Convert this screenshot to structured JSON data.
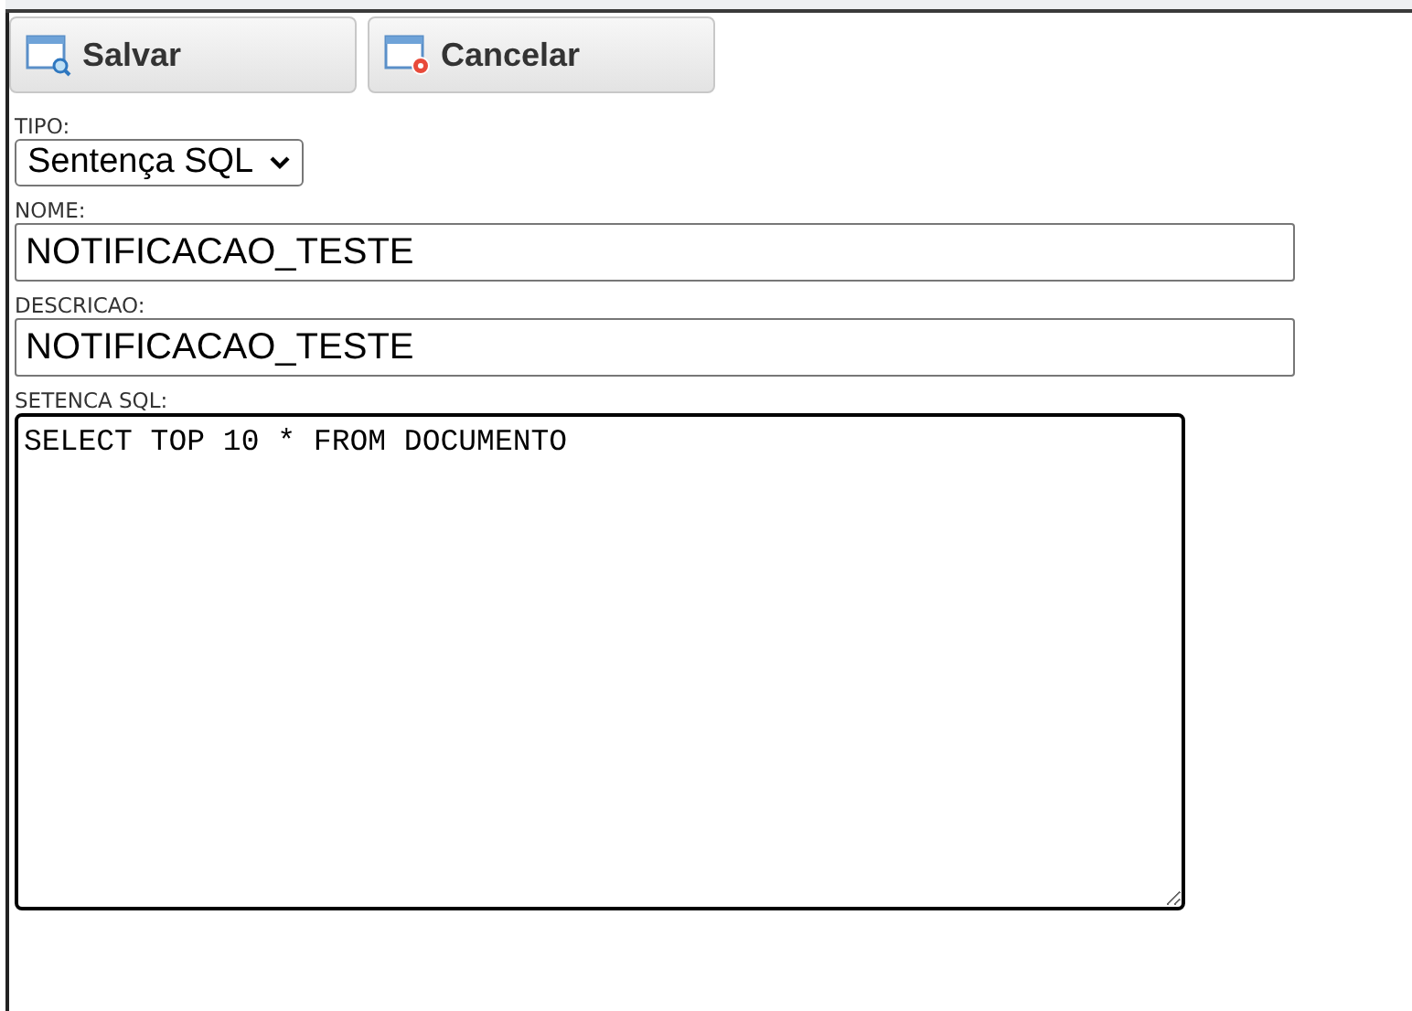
{
  "toolbar": {
    "buttons": [
      {
        "label": "Salvar",
        "kind": "save"
      },
      {
        "label": "Cancelar",
        "kind": "cancel"
      }
    ]
  },
  "form": {
    "fields": [
      {
        "label": "TIPO:",
        "kind": "select",
        "value": "Sentença SQL"
      },
      {
        "label": "NOME:",
        "kind": "text",
        "value": "NOTIFICACAO_TESTE"
      },
      {
        "label": "DESCRICAO:",
        "kind": "text",
        "value": "NOTIFICACAO_TESTE"
      },
      {
        "label": "SETENCA SQL:",
        "kind": "textarea",
        "value": "SELECT TOP 10 * FROM DOCUMENTO"
      }
    ]
  }
}
